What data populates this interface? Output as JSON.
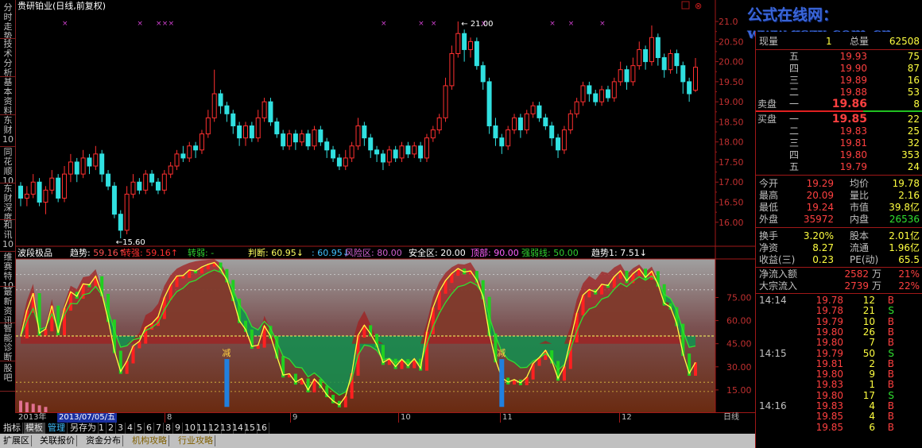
{
  "title": "贵研铂业(日线,前复权)",
  "left_tabs": [
    "分时走势",
    "技术分析",
    "基本资料",
    "东财10",
    "同花顺10",
    "东财深度",
    "和讯10",
    "维赛特10",
    "最新资讯",
    "智能诊断",
    "股吧"
  ],
  "price_axis": [
    "21.0",
    "20.50",
    "20.00",
    "19.50",
    "19.00",
    "18.50",
    "18.00",
    "17.50",
    "17.00",
    "16.50",
    "16.00"
  ],
  "price_ylim": [
    15.6,
    21.1
  ],
  "price_max_label": "21.00",
  "price_min_label": "15.60",
  "ind_axis": [
    "75.00",
    "60.00",
    "45.00",
    "30.00",
    "15.00"
  ],
  "indicator_line": {
    "name": "波段极品",
    "items": [
      {
        "k": "趋势:",
        "v": "59.16",
        "a": "↑",
        "c": "#ffffff",
        "vc": "#ff5050"
      },
      {
        "k": "转强:",
        "v": "59.16",
        "a": "↑",
        "c": "#ff3030",
        "vc": "#ff3030"
      },
      {
        "k": "转弱:",
        "v": "-",
        "a": "",
        "c": "#30d030",
        "vc": "#30d030"
      },
      {
        "k": "判断:",
        "v": "60.95",
        "a": "↓",
        "c": "#ffff60",
        "vc": "#ffff60"
      },
      {
        "k": ":",
        "v": "60.95",
        "a": "↓",
        "c": "#40c0ff",
        "vc": "#40c0ff"
      },
      {
        "k": "风险区:",
        "v": "80.00",
        "a": "",
        "c": "#d060d0",
        "vc": "#d060d0"
      },
      {
        "k": "安全区:",
        "v": "20.00",
        "a": "",
        "c": "#ffffff",
        "vc": "#ffffff"
      },
      {
        "k": "顶部:",
        "v": "90.00",
        "a": "",
        "c": "#ff60ff",
        "vc": "#ff60ff"
      },
      {
        "k": "强弱线:",
        "v": "50.00",
        "a": "",
        "c": "#30d030",
        "vc": "#30d030"
      },
      {
        "k": "趋势1:",
        "v": "7.51",
        "a": "↓",
        "c": "#ffffff",
        "vc": "#ffffff"
      }
    ]
  },
  "reduce_label": "减",
  "date_bar": {
    "year": "2013年",
    "date": "2013/07/05/五",
    "months": [
      "8",
      "9",
      "10",
      "11",
      "12"
    ]
  },
  "period_label": "日线",
  "toolbar": [
    "指标",
    "模板",
    "管理",
    "另存为",
    "1",
    "2",
    "3",
    "4",
    "5",
    "6",
    "7",
    "8",
    "9",
    "10",
    "11",
    "12",
    "13",
    "14",
    "15",
    "16"
  ],
  "bottom_tabs": [
    "扩展区",
    "关联报价",
    "资金分布",
    "机构攻略",
    "行业攻略"
  ],
  "logo_text": "公式在线网：www.gszx.com.cn",
  "quote": {
    "weibi": {
      "l1": "现量",
      "v1": "1",
      "l2": "总量",
      "v2": "62508"
    },
    "sell_label": "卖盘",
    "buy_label": "买盘",
    "asks": [
      {
        "n": "五",
        "p": "19.93",
        "v": "75"
      },
      {
        "n": "四",
        "p": "19.90",
        "v": "87"
      },
      {
        "n": "三",
        "p": "19.89",
        "v": "16"
      },
      {
        "n": "二",
        "p": "19.88",
        "v": "53"
      },
      {
        "n": "一",
        "p": "19.86",
        "v": "8"
      }
    ],
    "bids": [
      {
        "n": "一",
        "p": "19.85",
        "v": "22"
      },
      {
        "n": "二",
        "p": "19.83",
        "v": "25"
      },
      {
        "n": "三",
        "p": "19.81",
        "v": "32"
      },
      {
        "n": "四",
        "p": "19.80",
        "v": "353"
      },
      {
        "n": "五",
        "p": "19.79",
        "v": "24"
      }
    ],
    "stats": [
      {
        "l1": "今开",
        "v1": "19.29",
        "l2": "均价",
        "v2": "19.78"
      },
      {
        "l1": "最高",
        "v1": "20.09",
        "l2": "量比",
        "v2": "2.16"
      },
      {
        "l1": "最低",
        "v1": "19.24",
        "l2": "市值",
        "v2": "39.8亿"
      },
      {
        "l1": "外盘",
        "v1": "35972",
        "l2": "内盘",
        "v2": "26536"
      }
    ],
    "fund": [
      {
        "l1": "换手",
        "v1": "3.20%",
        "l2": "股本",
        "v2": "2.01亿"
      },
      {
        "l1": "净资",
        "v1": "8.27",
        "l2": "流通",
        "v2": "1.96亿"
      },
      {
        "l1": "收益(三)",
        "v1": "0.23",
        "l2": "PE(动)",
        "v2": "65.5"
      }
    ],
    "flows": [
      {
        "l": "净流入额",
        "v": "2582",
        "u": "万",
        "p": "21%"
      },
      {
        "l": "大宗流入",
        "v": "2739",
        "u": "万",
        "p": "22%"
      }
    ],
    "ticks": [
      {
        "t": "14:14",
        "p": "19.78",
        "v": "12",
        "s": "B"
      },
      {
        "t": "",
        "p": "19.78",
        "v": "21",
        "s": "S"
      },
      {
        "t": "",
        "p": "19.79",
        "v": "10",
        "s": "B"
      },
      {
        "t": "",
        "p": "19.80",
        "v": "26",
        "s": "B"
      },
      {
        "t": "",
        "p": "19.80",
        "v": "7",
        "s": "B"
      },
      {
        "t": "14:15",
        "p": "19.79",
        "v": "50",
        "s": "S"
      },
      {
        "t": "",
        "p": "19.81",
        "v": "2",
        "s": "B"
      },
      {
        "t": "",
        "p": "19.80",
        "v": "9",
        "s": "B"
      },
      {
        "t": "",
        "p": "19.83",
        "v": "1",
        "s": "B"
      },
      {
        "t": "",
        "p": "19.80",
        "v": "17",
        "s": "S"
      },
      {
        "t": "14:16",
        "p": "19.83",
        "v": "4",
        "s": "B"
      },
      {
        "t": "",
        "p": "19.85",
        "v": "4",
        "s": "B"
      },
      {
        "t": "",
        "p": "19.85",
        "v": "6",
        "s": "B"
      }
    ]
  },
  "chart_data": {
    "type": "candlestick",
    "title": "贵研铂业(日线,前复权)",
    "candles": [
      [
        16.9,
        16.6,
        17.0,
        16.4
      ],
      [
        16.6,
        16.7,
        16.9,
        16.4
      ],
      [
        16.7,
        17.0,
        17.2,
        16.6
      ],
      [
        17.0,
        16.5,
        17.1,
        16.4
      ],
      [
        16.5,
        16.8,
        16.9,
        16.2
      ],
      [
        16.8,
        17.1,
        17.3,
        16.7
      ],
      [
        17.1,
        16.6,
        17.2,
        16.5
      ],
      [
        16.6,
        17.2,
        17.4,
        16.5
      ],
      [
        17.2,
        17.5,
        17.7,
        17.0
      ],
      [
        17.5,
        17.2,
        17.6,
        17.0
      ],
      [
        17.2,
        17.6,
        17.8,
        17.1
      ],
      [
        17.6,
        17.4,
        17.7,
        17.2
      ],
      [
        17.4,
        17.7,
        17.9,
        17.3
      ],
      [
        17.7,
        17.2,
        17.8,
        17.0
      ],
      [
        17.2,
        16.9,
        17.3,
        16.8
      ],
      [
        16.9,
        16.2,
        17.0,
        16.1
      ],
      [
        16.2,
        15.8,
        16.3,
        15.6
      ],
      [
        15.8,
        16.7,
        16.9,
        15.7
      ],
      [
        16.7,
        17.0,
        17.2,
        16.6
      ],
      [
        17.0,
        16.8,
        17.1,
        16.7
      ],
      [
        16.8,
        17.2,
        17.3,
        16.7
      ],
      [
        17.2,
        17.0,
        17.3,
        16.9
      ],
      [
        17.0,
        16.8,
        17.1,
        16.7
      ],
      [
        16.8,
        17.2,
        17.3,
        16.7
      ],
      [
        17.2,
        17.4,
        17.5,
        17.1
      ],
      [
        17.4,
        17.7,
        17.8,
        17.3
      ],
      [
        17.7,
        17.6,
        17.9,
        17.5
      ],
      [
        17.6,
        17.9,
        18.0,
        17.5
      ],
      [
        17.9,
        17.8,
        18.0,
        17.6
      ],
      [
        17.8,
        18.2,
        18.3,
        17.7
      ],
      [
        18.2,
        18.6,
        18.8,
        18.1
      ],
      [
        18.6,
        19.2,
        19.8,
        18.5
      ],
      [
        19.2,
        18.9,
        19.3,
        18.7
      ],
      [
        18.9,
        18.7,
        19.0,
        18.5
      ],
      [
        18.7,
        18.4,
        18.8,
        18.2
      ],
      [
        18.4,
        18.1,
        18.5,
        17.9
      ],
      [
        18.1,
        18.4,
        18.5,
        17.9
      ],
      [
        18.4,
        18.1,
        18.5,
        18.0
      ],
      [
        18.1,
        18.6,
        18.8,
        18.0
      ],
      [
        18.6,
        19.0,
        19.1,
        18.5
      ],
      [
        19.0,
        18.5,
        19.1,
        18.4
      ],
      [
        18.5,
        18.2,
        18.6,
        18.1
      ],
      [
        18.2,
        17.9,
        18.3,
        17.8
      ],
      [
        17.9,
        18.2,
        18.3,
        17.8
      ],
      [
        18.2,
        18.0,
        18.3,
        17.8
      ],
      [
        18.0,
        18.2,
        18.3,
        17.9
      ],
      [
        18.2,
        17.9,
        18.3,
        17.8
      ],
      [
        17.9,
        18.3,
        18.4,
        17.8
      ],
      [
        18.3,
        18.0,
        18.4,
        17.9
      ],
      [
        18.0,
        17.8,
        18.1,
        17.6
      ],
      [
        17.8,
        17.6,
        17.9,
        17.5
      ],
      [
        17.6,
        17.4,
        17.7,
        17.3
      ],
      [
        17.4,
        17.6,
        17.8,
        17.3
      ],
      [
        17.6,
        17.9,
        18.0,
        17.5
      ],
      [
        17.9,
        18.4,
        18.6,
        17.8
      ],
      [
        18.4,
        18.1,
        18.5,
        17.9
      ],
      [
        18.1,
        17.8,
        18.2,
        17.6
      ],
      [
        17.8,
        17.7,
        17.9,
        17.5
      ],
      [
        17.7,
        17.5,
        17.8,
        17.3
      ],
      [
        17.5,
        17.8,
        17.9,
        17.4
      ],
      [
        17.8,
        17.6,
        17.9,
        17.5
      ],
      [
        17.6,
        17.9,
        18.0,
        17.5
      ],
      [
        17.9,
        17.7,
        18.0,
        17.6
      ],
      [
        17.7,
        17.9,
        18.0,
        17.6
      ],
      [
        17.9,
        17.6,
        18.0,
        17.5
      ],
      [
        17.6,
        18.1,
        18.2,
        17.5
      ],
      [
        18.1,
        18.3,
        18.4,
        18.0
      ],
      [
        18.3,
        18.6,
        18.7,
        18.2
      ],
      [
        18.6,
        19.4,
        19.6,
        18.5
      ],
      [
        19.4,
        20.2,
        20.4,
        19.3
      ],
      [
        20.2,
        20.7,
        21.0,
        20.1
      ],
      [
        20.7,
        20.3,
        20.8,
        20.0
      ],
      [
        20.3,
        20.5,
        20.6,
        20.1
      ],
      [
        20.5,
        19.9,
        20.6,
        19.8
      ],
      [
        19.9,
        19.5,
        20.0,
        19.3
      ],
      [
        19.5,
        18.4,
        19.6,
        18.2
      ],
      [
        18.4,
        18.1,
        18.6,
        17.9
      ],
      [
        18.1,
        17.9,
        18.2,
        17.7
      ],
      [
        17.9,
        18.3,
        18.4,
        17.8
      ],
      [
        18.3,
        18.6,
        18.7,
        18.2
      ],
      [
        18.6,
        18.3,
        18.7,
        18.1
      ],
      [
        18.3,
        18.7,
        18.8,
        18.2
      ],
      [
        18.7,
        18.9,
        19.0,
        18.6
      ],
      [
        18.9,
        18.6,
        19.0,
        18.5
      ],
      [
        18.6,
        18.4,
        18.7,
        18.3
      ],
      [
        18.4,
        18.1,
        18.5,
        17.9
      ],
      [
        18.1,
        17.8,
        18.2,
        17.6
      ],
      [
        17.8,
        18.3,
        18.4,
        17.7
      ],
      [
        18.3,
        18.7,
        18.8,
        18.2
      ],
      [
        18.7,
        19.0,
        19.1,
        18.6
      ],
      [
        19.0,
        19.4,
        19.5,
        18.9
      ],
      [
        19.4,
        19.2,
        19.5,
        19.0
      ],
      [
        19.2,
        19.0,
        19.3,
        18.9
      ],
      [
        19.0,
        19.3,
        19.4,
        18.9
      ],
      [
        19.3,
        19.1,
        19.4,
        19.0
      ],
      [
        19.1,
        19.5,
        19.6,
        19.0
      ],
      [
        19.5,
        19.8,
        20.0,
        19.4
      ],
      [
        19.8,
        19.5,
        19.9,
        19.3
      ],
      [
        19.5,
        19.9,
        20.1,
        19.4
      ],
      [
        19.9,
        20.3,
        20.5,
        19.8
      ],
      [
        20.3,
        20.0,
        20.4,
        19.8
      ],
      [
        20.0,
        20.6,
        20.9,
        19.9
      ],
      [
        20.6,
        20.1,
        20.7,
        19.9
      ],
      [
        20.1,
        19.8,
        20.2,
        19.6
      ],
      [
        19.8,
        20.2,
        20.3,
        19.7
      ],
      [
        20.2,
        19.9,
        20.3,
        19.7
      ],
      [
        19.9,
        19.5,
        20.0,
        19.2
      ],
      [
        19.5,
        19.2,
        19.6,
        19.0
      ],
      [
        19.29,
        19.86,
        20.09,
        19.24
      ]
    ],
    "indicator": {
      "name": "波段极品",
      "ylim": [
        0,
        100
      ],
      "levels": [
        20,
        50,
        80,
        90
      ]
    }
  }
}
